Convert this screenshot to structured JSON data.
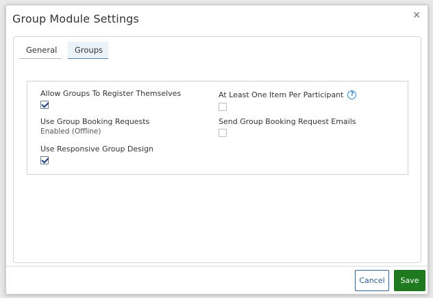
{
  "dialog": {
    "title": "Group Module Settings",
    "close_glyph": "×"
  },
  "tabs": [
    {
      "label": "General",
      "active": false
    },
    {
      "label": "Groups",
      "active": true
    }
  ],
  "settings": {
    "allow_groups": {
      "label": "Allow Groups To Register Themselves",
      "checked": true
    },
    "use_booking": {
      "label": "Use Group Booking Requests",
      "value": "Enabled (Offline)"
    },
    "responsive": {
      "label": "Use Responsive Group Design",
      "checked": true
    },
    "at_least_one": {
      "label": "At Least One Item Per Participant",
      "checked": false,
      "help_glyph": "?"
    },
    "send_emails": {
      "label": "Send Group Booking Request Emails",
      "checked": false
    }
  },
  "footer": {
    "cancel_label": "Cancel",
    "save_label": "Save"
  },
  "colors": {
    "save_bg": "#1f7a1f",
    "cancel_border": "#34608f",
    "active_tab_bg": "#eaf2fa",
    "help_icon": "#2a83c6"
  }
}
